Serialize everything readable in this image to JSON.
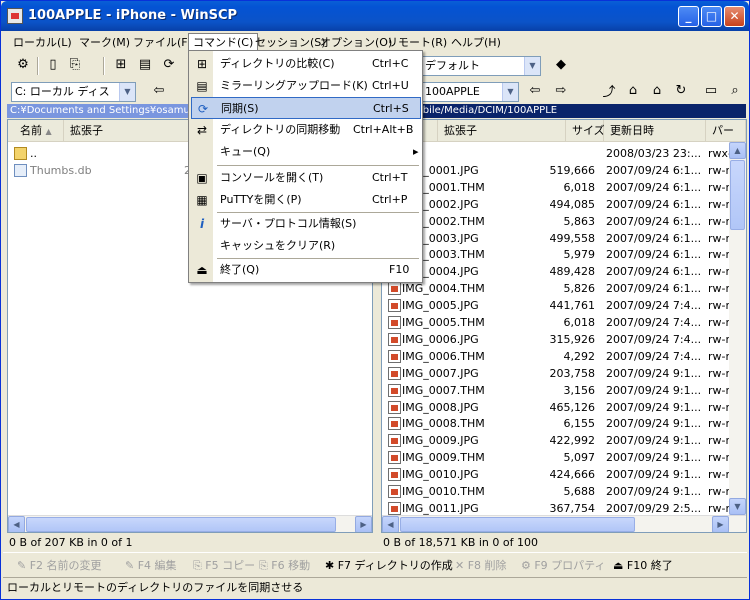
{
  "window": {
    "title": "100APPLE - iPhone - WinSCP"
  },
  "menu": [
    "ローカル(L)",
    "マーク(M)",
    "ファイル(F)",
    "コマンド(C)",
    "セッション(S)",
    "オプション(O)",
    "リモート(R)",
    "ヘルプ(H)"
  ],
  "toolbar": {
    "session_combo": "デフォルト",
    "local_drive": "C: ローカル ディス",
    "remote_dir": "100APPLE"
  },
  "local": {
    "path": "C:¥Documents and Settings¥osamu¥My",
    "headers": [
      "名前",
      "拡張子"
    ],
    "files": [
      {
        "name": "..",
        "size": ""
      },
      {
        "name": "Thumbs.db",
        "size": "2"
      }
    ],
    "status": "0 B of 207 KB in 0 of 1"
  },
  "remote": {
    "path": "/var/mobile/Media/DCIM/100APPLE",
    "headers": [
      "拡張子",
      "サイズ",
      "更新日時",
      "パー"
    ],
    "files": [
      {
        "name": "..",
        "size": "",
        "date": "2008/03/23 23:...",
        "perm": "rwx-"
      },
      {
        "name": "IMG_0001.JPG",
        "size": "519,666",
        "date": "2007/09/24 6:1...",
        "perm": "rw-r"
      },
      {
        "name": "IMG_0001.THM",
        "size": "6,018",
        "date": "2007/09/24 6:1...",
        "perm": "rw-r"
      },
      {
        "name": "IMG_0002.JPG",
        "size": "494,085",
        "date": "2007/09/24 6:1...",
        "perm": "rw-r"
      },
      {
        "name": "IMG_0002.THM",
        "size": "5,863",
        "date": "2007/09/24 6:1...",
        "perm": "rw-r"
      },
      {
        "name": "IMG_0003.JPG",
        "size": "499,558",
        "date": "2007/09/24 6:1...",
        "perm": "rw-r"
      },
      {
        "name": "IMG_0003.THM",
        "size": "5,979",
        "date": "2007/09/24 6:1...",
        "perm": "rw-r"
      },
      {
        "name": "IMG_0004.JPG",
        "size": "489,428",
        "date": "2007/09/24 6:1...",
        "perm": "rw-r"
      },
      {
        "name": "IMG_0004.THM",
        "size": "5,826",
        "date": "2007/09/24 6:1...",
        "perm": "rw-r"
      },
      {
        "name": "IMG_0005.JPG",
        "size": "441,761",
        "date": "2007/09/24 7:4...",
        "perm": "rw-r"
      },
      {
        "name": "IMG_0005.THM",
        "size": "6,018",
        "date": "2007/09/24 7:4...",
        "perm": "rw-r"
      },
      {
        "name": "IMG_0006.JPG",
        "size": "315,926",
        "date": "2007/09/24 7:4...",
        "perm": "rw-r"
      },
      {
        "name": "IMG_0006.THM",
        "size": "4,292",
        "date": "2007/09/24 7:4...",
        "perm": "rw-r"
      },
      {
        "name": "IMG_0007.JPG",
        "size": "203,758",
        "date": "2007/09/24 9:1...",
        "perm": "rw-r"
      },
      {
        "name": "IMG_0007.THM",
        "size": "3,156",
        "date": "2007/09/24 9:1...",
        "perm": "rw-r"
      },
      {
        "name": "IMG_0008.JPG",
        "size": "465,126",
        "date": "2007/09/24 9:1...",
        "perm": "rw-r"
      },
      {
        "name": "IMG_0008.THM",
        "size": "6,155",
        "date": "2007/09/24 9:1...",
        "perm": "rw-r"
      },
      {
        "name": "IMG_0009.JPG",
        "size": "422,992",
        "date": "2007/09/24 9:1...",
        "perm": "rw-r"
      },
      {
        "name": "IMG_0009.THM",
        "size": "5,097",
        "date": "2007/09/24 9:1...",
        "perm": "rw-r"
      },
      {
        "name": "IMG_0010.JPG",
        "size": "424,666",
        "date": "2007/09/24 9:1...",
        "perm": "rw-r"
      },
      {
        "name": "IMG_0010.THM",
        "size": "5,688",
        "date": "2007/09/24 9:1...",
        "perm": "rw-r"
      },
      {
        "name": "IMG_0011.JPG",
        "size": "367,754",
        "date": "2007/09/29 2:5...",
        "perm": "rw-r"
      }
    ],
    "status": "0 B of 18,571 KB in 0 of 100"
  },
  "dropdown": [
    {
      "label": "ディレクトリの比較(C)",
      "shortcut": "Ctrl+C",
      "icon": "compare-icon"
    },
    {
      "label": "ミラーリングアップロード(K)",
      "shortcut": "Ctrl+U",
      "icon": "mirror-upload-icon"
    },
    {
      "label": "同期(S)",
      "shortcut": "Ctrl+S",
      "icon": "sync-icon"
    },
    {
      "label": "ディレクトリの同期移動",
      "shortcut": "Ctrl+Alt+B",
      "icon": "sync-browse-icon"
    },
    {
      "label": "キュー(Q)",
      "shortcut": "",
      "icon": ""
    },
    {
      "label": "コンソールを開く(T)",
      "shortcut": "Ctrl+T",
      "icon": "console-icon"
    },
    {
      "label": "PuTTYを開く(P)",
      "shortcut": "Ctrl+P",
      "icon": "putty-icon"
    },
    {
      "label": "サーバ・プロトコル情報(S)",
      "shortcut": "",
      "icon": "info-icon"
    },
    {
      "label": "キャッシュをクリア(R)",
      "shortcut": "",
      "icon": ""
    },
    {
      "label": "終了(Q)",
      "shortcut": "F10",
      "icon": "exit-icon"
    }
  ],
  "fkeys": [
    "F2 名前の変更",
    "F4 編集",
    "F5 コピー",
    "F6 移動",
    "F7 ディレクトリの作成",
    "F8 削除",
    "F9 プロパティ",
    "F10 終了"
  ],
  "bottom_status": "ローカルとリモートのディレクトリのファイルを同期させる"
}
